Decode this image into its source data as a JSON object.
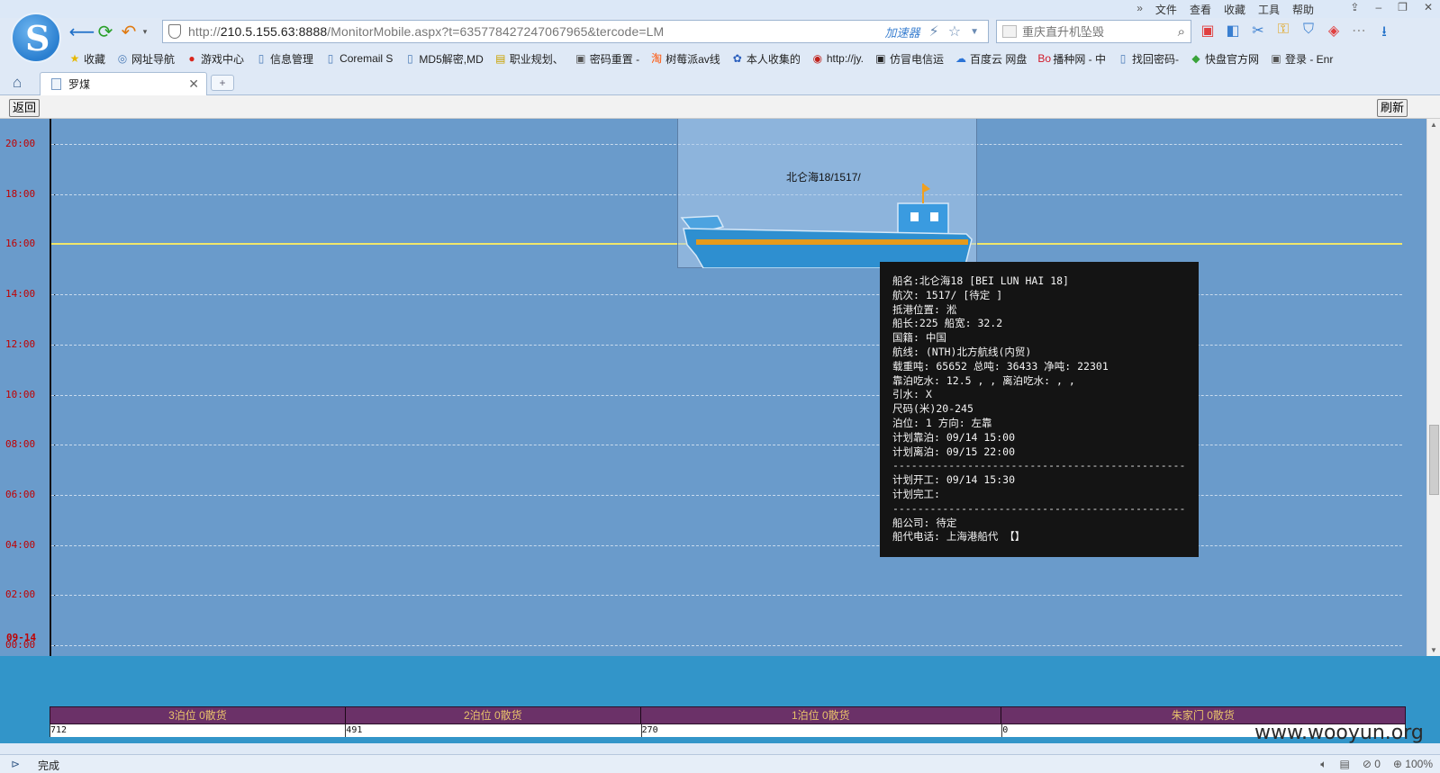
{
  "browser": {
    "menu": [
      "文件",
      "查看",
      "收藏",
      "工具",
      "帮助"
    ],
    "url_prefix": "http://",
    "url_host": "210.5.155.63:8888",
    "url_path": "/MonitorMobile.aspx?t=635778427247067965&tercode=LM",
    "accelerator": "加速器",
    "search_placeholder": "重庆直升机坠毁",
    "bookmarks": [
      {
        "label": "收藏",
        "icon": "★",
        "color": "#e6b800"
      },
      {
        "label": "网址导航",
        "icon": "◎",
        "color": "#4a7bb7"
      },
      {
        "label": "游戏中心",
        "icon": "●",
        "color": "#d9261c"
      },
      {
        "label": "信息管理",
        "icon": "▯",
        "color": "#4a7bb7"
      },
      {
        "label": "Coremail S",
        "icon": "▯",
        "color": "#4a7bb7"
      },
      {
        "label": "MD5解密,MD",
        "icon": "▯",
        "color": "#4a7bb7"
      },
      {
        "label": "职业规划、",
        "icon": "▤",
        "color": "#c9a200"
      },
      {
        "label": "密码重置 -",
        "icon": "▣",
        "color": "#555"
      },
      {
        "label": "树莓派av线",
        "icon": "淘",
        "color": "#ff5000"
      },
      {
        "label": "本人收集的",
        "icon": "✿",
        "color": "#2b5fbd"
      },
      {
        "label": "http://jy.",
        "icon": "◉",
        "color": "#c0221b"
      },
      {
        "label": "仿冒电信运",
        "icon": "▣",
        "color": "#222"
      },
      {
        "label": "百度云 网盘",
        "icon": "☁",
        "color": "#2b73d6"
      },
      {
        "label": "播种网 - 中",
        "icon": "Bo",
        "color": "#d11a2a"
      },
      {
        "label": "找回密码-",
        "icon": "▯",
        "color": "#4a7bb7"
      },
      {
        "label": "快盘官方网",
        "icon": "◆",
        "color": "#3aa33a"
      },
      {
        "label": "登录 - Enr",
        "icon": "▣",
        "color": "#555"
      }
    ],
    "tab_title": "罗煤",
    "status": "完成",
    "zoom": "100%",
    "status_count": "0"
  },
  "page": {
    "back_label": "返回",
    "refresh_label": "刷新",
    "watermark": "www.wooyun.org"
  },
  "timeline": {
    "ticks": [
      "20:00",
      "18:00",
      "16:00",
      "14:00",
      "12:00",
      "10:00",
      "08:00",
      "06:00",
      "04:00",
      "02:00",
      "00:00"
    ],
    "date": "09-14",
    "current_time_hours": 16
  },
  "vessel": {
    "label": "北仑海18/1517/",
    "colors": {
      "hull": "#2e8fd0",
      "stripe": "#e69a1a",
      "cabin": "#3a9be0",
      "flag": "#f0a020"
    }
  },
  "tooltip": {
    "lines": [
      "船名:北仑海18 [BEI LUN HAI 18]",
      "航次: 1517/ [待定 ]",
      "抵港位置: 淞",
      "船长:225 船宽: 32.2",
      "国籍: 中国",
      "航线: (NTH)北方航线(内贸)",
      "载重吨: 65652 总吨: 36433 净吨: 22301",
      "靠泊吃水: 12.5 , , 离泊吃水: , ,",
      "引水: X",
      "尺码(米)20-245",
      "泊位: 1 方向: 左靠",
      "计划靠泊: 09/14 15:00",
      "计划离泊: 09/15 22:00",
      "-------------------------------------------------------",
      "计划开工: 09/14 15:30",
      "计划完工:",
      "-------------------------------------------------------",
      "船公司: 待定",
      "船代电话: 上海港船代 【】"
    ]
  },
  "berths": [
    {
      "label": "3泊位 0散货",
      "share": 0.218
    },
    {
      "label": "2泊位 0散货",
      "share": 0.218
    },
    {
      "label": "1泊位 0散货",
      "share": 0.266
    },
    {
      "label": "朱家门 0散货",
      "share": 0.298
    }
  ],
  "scale": [
    "712",
    "491",
    "270",
    "0"
  ]
}
